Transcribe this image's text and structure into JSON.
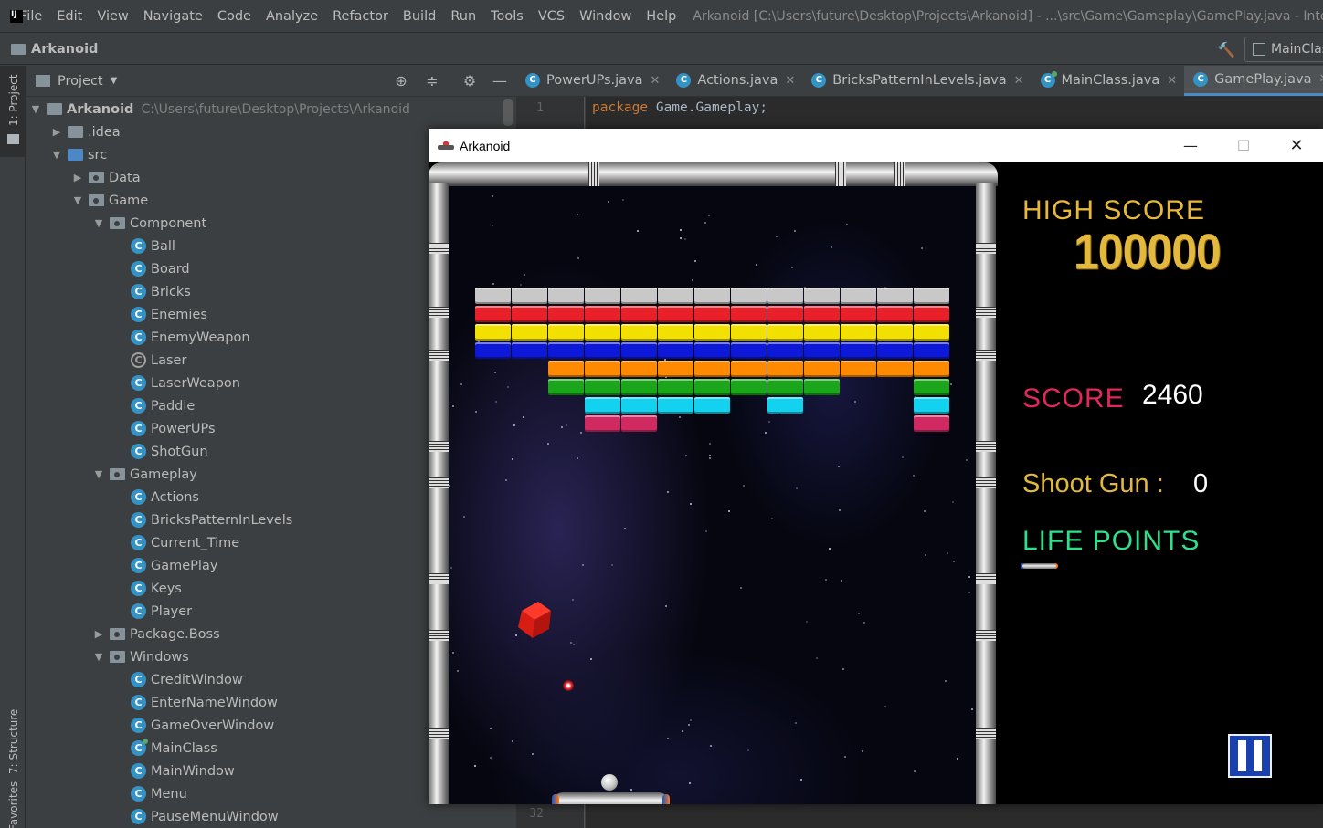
{
  "menubar": {
    "items": [
      "File",
      "Edit",
      "View",
      "Navigate",
      "Code",
      "Analyze",
      "Refactor",
      "Build",
      "Run",
      "Tools",
      "VCS",
      "Window",
      "Help"
    ],
    "window_title": "Arkanoid [C:\\Users\\future\\Desktop\\Projects\\Arkanoid] - ...\\src\\Game\\Gameplay\\GamePlay.java - IntelliJ IDEA"
  },
  "navbar": {
    "project": "Arkanoid",
    "run_config": "MainClass"
  },
  "left_strip": {
    "project_tab": "1: Project",
    "structure_tab": "7: Structure",
    "favorites_tab": "Favorites"
  },
  "project_panel": {
    "title": "Project",
    "tree": [
      {
        "label": "Arkanoid",
        "type": "root",
        "path": "C:\\Users\\future\\Desktop\\Projects\\Arkanoid"
      },
      {
        "label": ".idea",
        "type": "folder"
      },
      {
        "label": "src",
        "type": "src-folder"
      },
      {
        "label": "Data",
        "type": "package"
      },
      {
        "label": "Game",
        "type": "package"
      },
      {
        "label": "Component",
        "type": "package"
      },
      {
        "label": "Ball",
        "type": "class"
      },
      {
        "label": "Board",
        "type": "class"
      },
      {
        "label": "Bricks",
        "type": "class"
      },
      {
        "label": "Enemies",
        "type": "class"
      },
      {
        "label": "EnemyWeapon",
        "type": "class"
      },
      {
        "label": "Laser",
        "type": "abstract-class"
      },
      {
        "label": "LaserWeapon",
        "type": "class"
      },
      {
        "label": "Paddle",
        "type": "class"
      },
      {
        "label": "PowerUPs",
        "type": "class"
      },
      {
        "label": "ShotGun",
        "type": "class"
      },
      {
        "label": "Gameplay",
        "type": "package"
      },
      {
        "label": "Actions",
        "type": "class"
      },
      {
        "label": "BricksPatternInLevels",
        "type": "class"
      },
      {
        "label": "Current_Time",
        "type": "class"
      },
      {
        "label": "GamePlay",
        "type": "class"
      },
      {
        "label": "Keys",
        "type": "class"
      },
      {
        "label": "Player",
        "type": "class"
      },
      {
        "label": "Package.Boss",
        "type": "package"
      },
      {
        "label": "Windows",
        "type": "package"
      },
      {
        "label": "CreditWindow",
        "type": "class"
      },
      {
        "label": "EnterNameWindow",
        "type": "class"
      },
      {
        "label": "GameOverWindow",
        "type": "class"
      },
      {
        "label": "MainClass",
        "type": "main-class"
      },
      {
        "label": "MainWindow",
        "type": "class"
      },
      {
        "label": "Menu",
        "type": "class"
      },
      {
        "label": "PauseMenuWindow",
        "type": "class"
      }
    ]
  },
  "editor": {
    "tabs": [
      {
        "label": "PowerUPs.java",
        "active": false
      },
      {
        "label": "Actions.java",
        "active": false
      },
      {
        "label": "BricksPatternInLevels.java",
        "active": false
      },
      {
        "label": "MainClass.java",
        "active": false
      },
      {
        "label": "GamePlay.java",
        "active": true
      }
    ],
    "line1_number": "1",
    "line1_keyword": "package",
    "line1_rest": " Game.Gameplay;",
    "bottom_line_number": "32"
  },
  "game_window": {
    "title": "Arkanoid",
    "controls": {
      "minimize": "—",
      "maximize": "☐",
      "close": "✕"
    },
    "hud": {
      "high_score_label": "HIGH SCORE",
      "high_score_value": "100000",
      "score_label": "SCORE",
      "score_value": "2460",
      "shoot_gun_label": "Shoot Gun :",
      "shoot_gun_value": "0",
      "life_points_label": "LIFE POINTS",
      "life_points": 1
    },
    "brick_colors": {
      "S": "#c8c8c8",
      "R": "#e8202a",
      "Y": "#f2e000",
      "B": "#0d18d8",
      "O": "#ff8a00",
      "G": "#1aa51a",
      "C": "#12d2f0",
      "P": "#d12a62"
    },
    "brick_rows": [
      "SSSSSSSSSSSSS",
      "RRRRRRRRRRRRR",
      "YYYYYYYYYYYYY",
      "BBBBBBBBBBBBB",
      "..OOOOOOOOOOO",
      "..GGGGGGGG..G",
      "...CCCC.C...C",
      "...PP.......P"
    ]
  }
}
